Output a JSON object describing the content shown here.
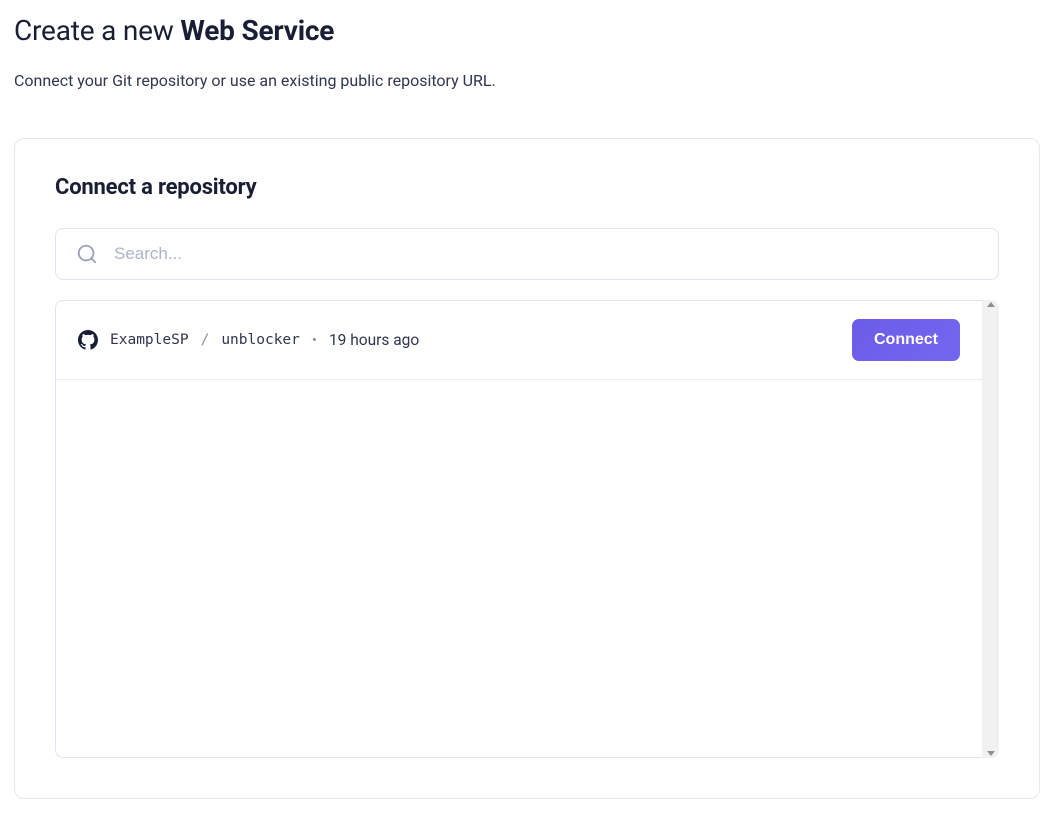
{
  "header": {
    "title_prefix": "Create a new ",
    "title_strong": "Web Service",
    "subtitle": "Connect your Git repository or use an existing public repository URL."
  },
  "panel": {
    "heading": "Connect a repository",
    "search_placeholder": "Search..."
  },
  "repos": [
    {
      "owner": "ExampleSP",
      "slash": "/",
      "name": "unblocker",
      "dot": "•",
      "time": "19 hours ago",
      "connect_label": "Connect"
    }
  ]
}
